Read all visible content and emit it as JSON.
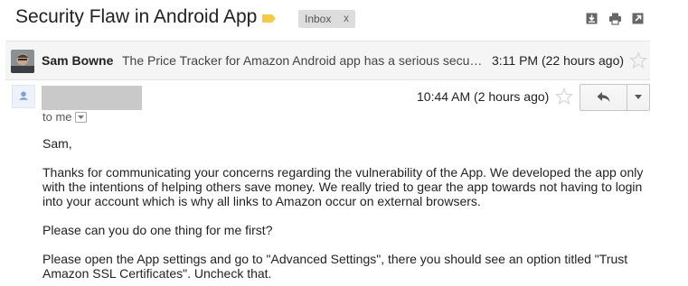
{
  "thread": {
    "subject": "Security Flaw in Android App",
    "label": "Inbox",
    "label_remove": "x",
    "important_color": "#f6ca45",
    "icons": [
      "download-icon",
      "print-icon",
      "new-window-icon"
    ]
  },
  "collapsed_message": {
    "sender": "Sam Bowne",
    "snippet": "The Price Tracker for Amazon Android app has a serious secu…",
    "date": "3:11 PM (22 hours ago)",
    "starred": false
  },
  "expanded_message": {
    "date": "10:44 AM (2 hours ago)",
    "starred": false,
    "to": "to me",
    "body": [
      "Sam,",
      "Thanks for communicating your concerns regarding the vulnerability of the App. We developed the app only with the intentions of helping others save money. We really tried to gear the app towards not having to login into your account which is why all links to Amazon occur on external browsers.",
      "Please can you do one thing for me first?",
      "Please open the App settings and go to \"Advanced Settings\", there you should see an option titled \"Trust Amazon SSL Certificates\". Uncheck that."
    ]
  }
}
